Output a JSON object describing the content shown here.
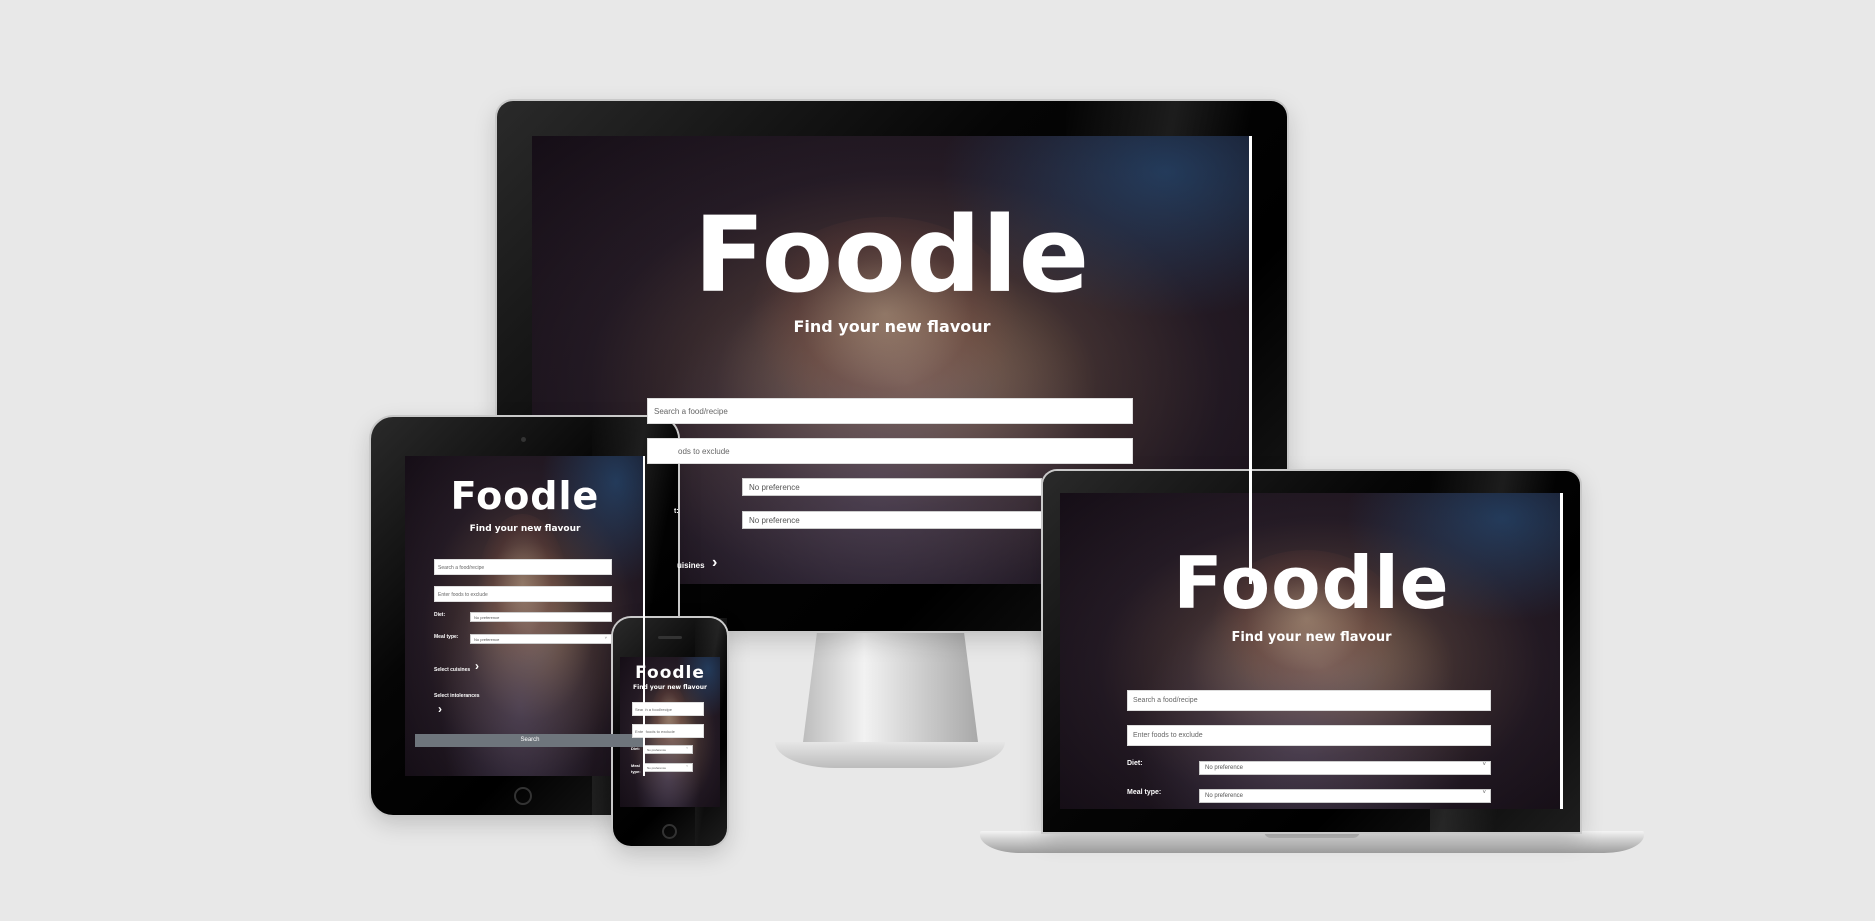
{
  "app": {
    "logo": "Foodle",
    "tagline": "Find your new flavour"
  },
  "search": {
    "food_placeholder": "Search a food/recipe",
    "exclude_placeholder": "Enter foods to exclude",
    "exclude_placeholder_cut": "ods to exclude"
  },
  "filters": {
    "diet_label": "Diet:",
    "diet_label_cut": "t:",
    "meal_type_label": "Meal type:",
    "meal_label_line1": "Meal",
    "meal_label_line2": "type:",
    "no_preference": "No preference",
    "select_cuisines": "Select cuisines",
    "cuisines_cut": "uisines",
    "select_intolerances": "Select intolerances"
  },
  "actions": {
    "search_button": "Search"
  },
  "icons": {
    "arrow": "chevron-right-icon",
    "dropdown": "chevron-down-icon"
  },
  "colors": {
    "background": "#e8e8e8",
    "search_button": "#6e757c"
  }
}
